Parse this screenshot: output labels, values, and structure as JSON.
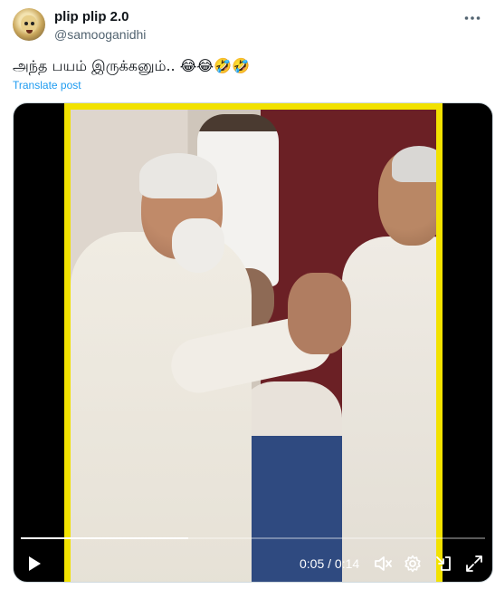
{
  "author": {
    "display_name": "plip plip 2.0",
    "handle": "@samooganidhi",
    "avatar_icon": "avatar-icon"
  },
  "menu": {
    "more_icon": "more-icon"
  },
  "tweet": {
    "text": "அந்த பயம் இருக்கனும்.. 😂😂🤣🤣",
    "translate_label": "Translate post"
  },
  "video": {
    "current_time": "0:05",
    "separator": "/",
    "duration": "0:14",
    "time_display": "0:05 / 0:14",
    "progress": 0.36,
    "controls": [
      "play-icon",
      "mute-icon",
      "settings-icon",
      "minimize-icon",
      "fullscreen-icon"
    ]
  },
  "colors": {
    "link": "#1d9bf0",
    "frame_border": "#f2e200",
    "secondary_text": "#536471"
  }
}
